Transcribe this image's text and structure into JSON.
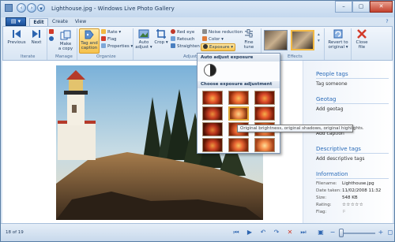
{
  "window": {
    "title": "Lighthouse.jpg - Windows Live Photo Gallery"
  },
  "tabs": {
    "items": [
      "Edit",
      "Create",
      "View"
    ]
  },
  "ribbon": {
    "groups": [
      "Iterate",
      "Manage",
      "Organize",
      "Adjustments",
      "Effects"
    ],
    "iterate": {
      "previous": "Previous",
      "next": "Next"
    },
    "manage": {
      "make_copy_1": "Make",
      "make_copy_2": "a copy"
    },
    "organize": {
      "tag_caption_1": "Tag and",
      "tag_caption_2": "caption",
      "rate": "Rate",
      "flag": "Flag",
      "properties": "Properties"
    },
    "adjustments": {
      "auto_adjust_1": "Auto",
      "auto_adjust_2": "adjust",
      "crop": "Crop",
      "red_eye": "Red eye",
      "retouch": "Retouch",
      "straighten": "Straighten",
      "noise_reduction": "Noise reduction",
      "color": "Color",
      "exposure": "Exposure",
      "fine_tune_1": "Fine",
      "fine_tune_2": "tune"
    },
    "revert_1": "Revert to",
    "revert_2": "original",
    "close_1": "Close",
    "close_2": "file"
  },
  "dropdown": {
    "auto_header": "Auto adjust exposure",
    "choose_header": "Choose exposure adjustment",
    "tooltip": "Original brightness, original shadows, original highlights."
  },
  "panel": {
    "people_tags": "People tags",
    "tag_someone": "Tag someone",
    "geotag": "Geotag",
    "add_geotag": "Add geotag",
    "add_caption": "Add caption",
    "descriptive_tags": "Descriptive tags",
    "add_descriptive": "Add descriptive tags",
    "information": "Information",
    "info": [
      {
        "label": "Filename:",
        "value": "Lighthouse.jpg"
      },
      {
        "label": "Date taken:",
        "value": "11/02/2008 11:32"
      },
      {
        "label": "Size:",
        "value": "548 KB"
      },
      {
        "label": "Rating:",
        "value": "☆☆☆☆☆"
      },
      {
        "label": "Flag:",
        "value": "⚐"
      }
    ]
  },
  "status": {
    "count": "18 of 19"
  },
  "colors": {
    "accent": "#2a6bb8",
    "ribbon_active": "#f6c24b",
    "close": "#c4412d"
  }
}
